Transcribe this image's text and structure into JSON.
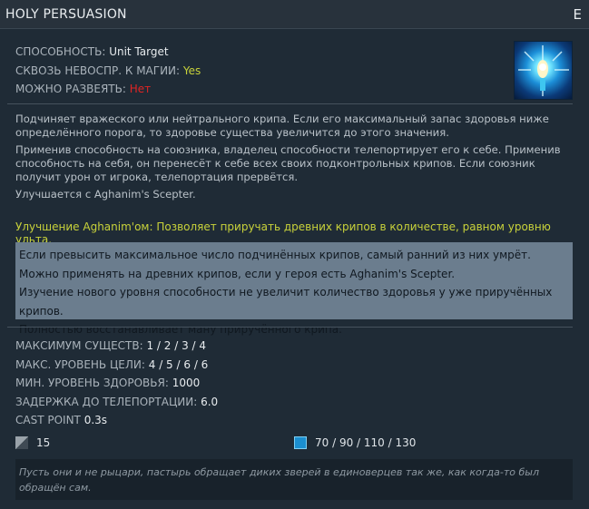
{
  "ability": {
    "name": "HOLY PERSUASION",
    "hotkey": "E",
    "icon": "holy-persuasion-icon"
  },
  "properties": [
    {
      "key": "СПОСОБНОСТЬ:",
      "value": "Unit Target"
    },
    {
      "key": "СКВОЗЬ НЕВОСПР. К МАГИИ:",
      "value": "Yes"
    },
    {
      "key": "МОЖНО РАЗВЕЯТЬ:",
      "value": "Нет"
    }
  ],
  "description": [
    "Подчиняет вражеского или нейтрального крипа. Если его максимальный запас здоровья ниже определённого порога, то здоровье существа увеличится до этого значения.",
    "Применив способность на союзника, владелец способности телепортирует его к себе. Применив способность на себя, он перенесёт к себе всех своих подконтрольных крипов. Если союзник получит урон от игрока, телепортация прервётся.",
    "Улучшается с Aghanim's Scepter."
  ],
  "aghanim_upgrade": "Улучшение Aghanim'ом: Позволяет приручать древних крипов в количестве, равном уровню ульта.",
  "notes": [
    "Если превысить максимальное число подчинённых крипов, самый ранний из них умрёт.",
    "Можно применять на древних крипов, если у героя есть Aghanim's Scepter.",
    "Изучение нового уровня способности не увеличит количество здоровья у уже приручённых крипов.",
    "Полностью восстанавливает ману приручённого крипа."
  ],
  "stats": [
    {
      "key": "МАКСИМУМ СУЩЕСТВ:",
      "value": "1 / 2 / 3 / 4"
    },
    {
      "key": "МАКС. УРОВЕНЬ ЦЕЛИ:",
      "value": "4 / 5 / 6 / 6"
    },
    {
      "key": "МИН. УРОВЕНЬ ЗДОРОВЬЯ:",
      "value": "1000"
    },
    {
      "key": "ЗАДЕРЖКА ДО ТЕЛЕПОРТАЦИИ:",
      "value": "6.0"
    },
    {
      "key": "CAST POINT",
      "value": "0.3s"
    }
  ],
  "cooldown": {
    "icon": "cooldown-icon",
    "value": "15"
  },
  "mana": {
    "icon": "mana-icon",
    "value": "70 / 90 / 110 / 130"
  },
  "lore": "Пусть они и не рыцари, пастырь обращает диких зверей в единоверцев так же, как когда-то был обращён сам.",
  "colors": {
    "yes": "#c8d23a",
    "no": "#e02424",
    "notes_bg": "#6b7d8e",
    "mana": "#1b8fd0"
  }
}
